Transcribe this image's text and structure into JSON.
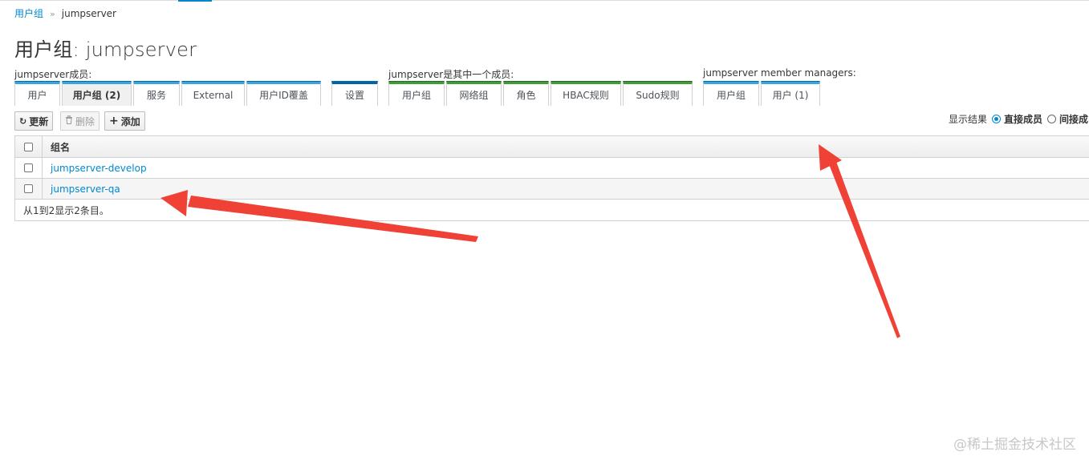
{
  "breadcrumb": {
    "parent": "用户组",
    "separator": "»",
    "current": "jumpserver"
  },
  "page_title": "用户组: jumpserver",
  "sections": {
    "members_label": "jumpserver成员:",
    "memberof_label": "jumpserver是其中一个成员:",
    "managers_label": "jumpserver member managers:"
  },
  "tabs": {
    "members": [
      "用户",
      "用户组 (2)",
      "服务",
      "External",
      "用户ID覆盖"
    ],
    "settings": "设置",
    "memberof": [
      "用户组",
      "网络组",
      "角色",
      "HBAC规则",
      "Sudo规则"
    ],
    "managers": [
      "用户组",
      "用户 (1)"
    ]
  },
  "toolbar": {
    "refresh": "更新",
    "refresh_icon": "refresh-icon",
    "delete": "删除",
    "delete_icon": "trash-icon",
    "add": "添加",
    "add_icon": "plus-icon"
  },
  "filter": {
    "label": "显示结果",
    "direct": "直接成员",
    "indirect": "间接成",
    "selected": "direct"
  },
  "table": {
    "header": "组名",
    "rows": [
      "jumpserver-develop",
      "jumpserver-qa"
    ],
    "footer": "从1到2显示2条目。"
  },
  "colors": {
    "link": "#0088ce",
    "tab_blue": "#39a5dc",
    "tab_green": "#3f9c35",
    "annotation_arrow": "#ef4136"
  },
  "watermark": "@稀土掘金技术社区"
}
